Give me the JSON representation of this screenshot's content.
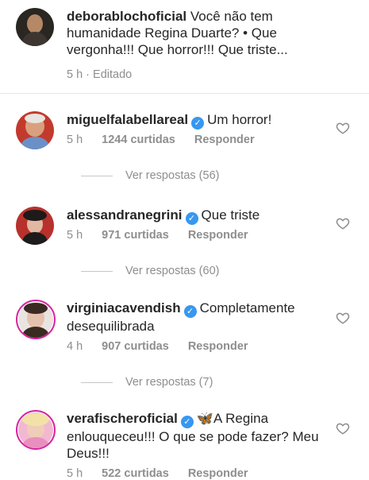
{
  "caption": {
    "username": "deborablochoficial",
    "text": "Você não tem humanidade Regina Duarte? • Que vergonha!!! Que horror!!! Que triste...",
    "time": "5 h",
    "edited": "· Editado"
  },
  "comments": [
    {
      "username": "miguelfalabellareal",
      "text": "Um horror!",
      "time": "5 h",
      "likes": "1244 curtidas",
      "reply": "Responder",
      "view_replies": "Ver respostas (56)"
    },
    {
      "username": "alessandranegrini",
      "text": "Que triste",
      "time": "5 h",
      "likes": "971 curtidas",
      "reply": "Responder",
      "view_replies": "Ver respostas (60)"
    },
    {
      "username": "virginiacavendish",
      "text": "Completamente desequilibrada",
      "time": "4 h",
      "likes": "907 curtidas",
      "reply": "Responder",
      "view_replies": "Ver respostas (7)"
    },
    {
      "username": "verafischeroficial",
      "emoji": "🦋",
      "text": "A Regina enlouqueceu!!! O que se pode fazer? Meu Deus!!!",
      "time": "5 h",
      "likes": "522 curtidas",
      "reply": "Responder"
    }
  ],
  "colors": {
    "verified": "#3897f0",
    "muted": "#8e8e8e",
    "story_ring": "#d6249f"
  },
  "icons": {
    "verified": "verified-badge-icon",
    "like": "heart-outline-icon"
  }
}
